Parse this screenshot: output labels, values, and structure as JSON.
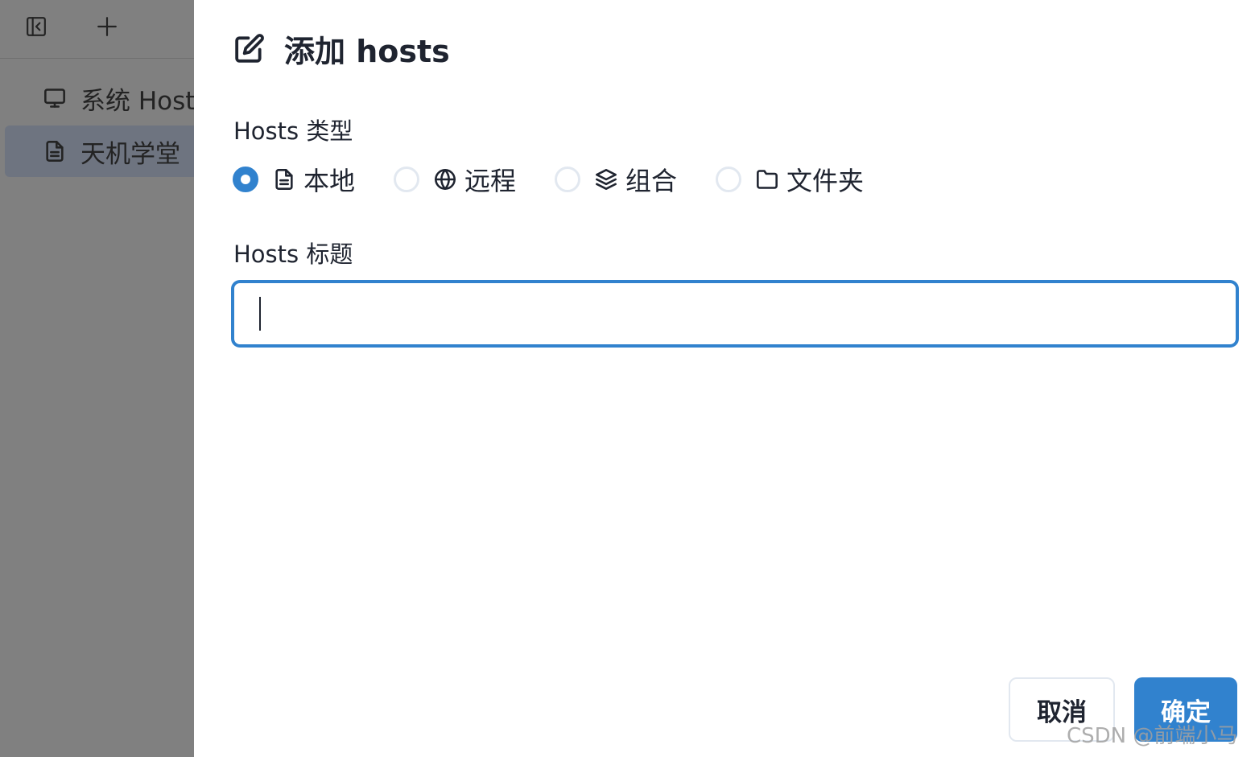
{
  "sidebar": {
    "toolbar": {
      "collapse_icon": "sidebar-collapse-icon",
      "add_icon": "plus-icon"
    },
    "items": [
      {
        "label": "系统 Hosts",
        "icon": "monitor-icon"
      },
      {
        "label": "天机学堂",
        "icon": "file-icon",
        "selected": true
      }
    ]
  },
  "dialog": {
    "title": "添加 hosts",
    "title_icon": "edit-icon",
    "type_label": "Hosts 类型",
    "type_options": [
      {
        "label": "本地",
        "icon": "file-icon",
        "checked": true
      },
      {
        "label": "远程",
        "icon": "globe-icon",
        "checked": false
      },
      {
        "label": "组合",
        "icon": "layers-icon",
        "checked": false
      },
      {
        "label": "文件夹",
        "icon": "folder-icon",
        "checked": false
      }
    ],
    "title_field_label": "Hosts 标题",
    "title_value": "",
    "cancel_label": "取消",
    "ok_label": "确定"
  },
  "watermark": "CSDN @前端小马",
  "colors": {
    "accent": "#3182ce",
    "overlay": "#808080",
    "selected_item": "#6e7480"
  }
}
